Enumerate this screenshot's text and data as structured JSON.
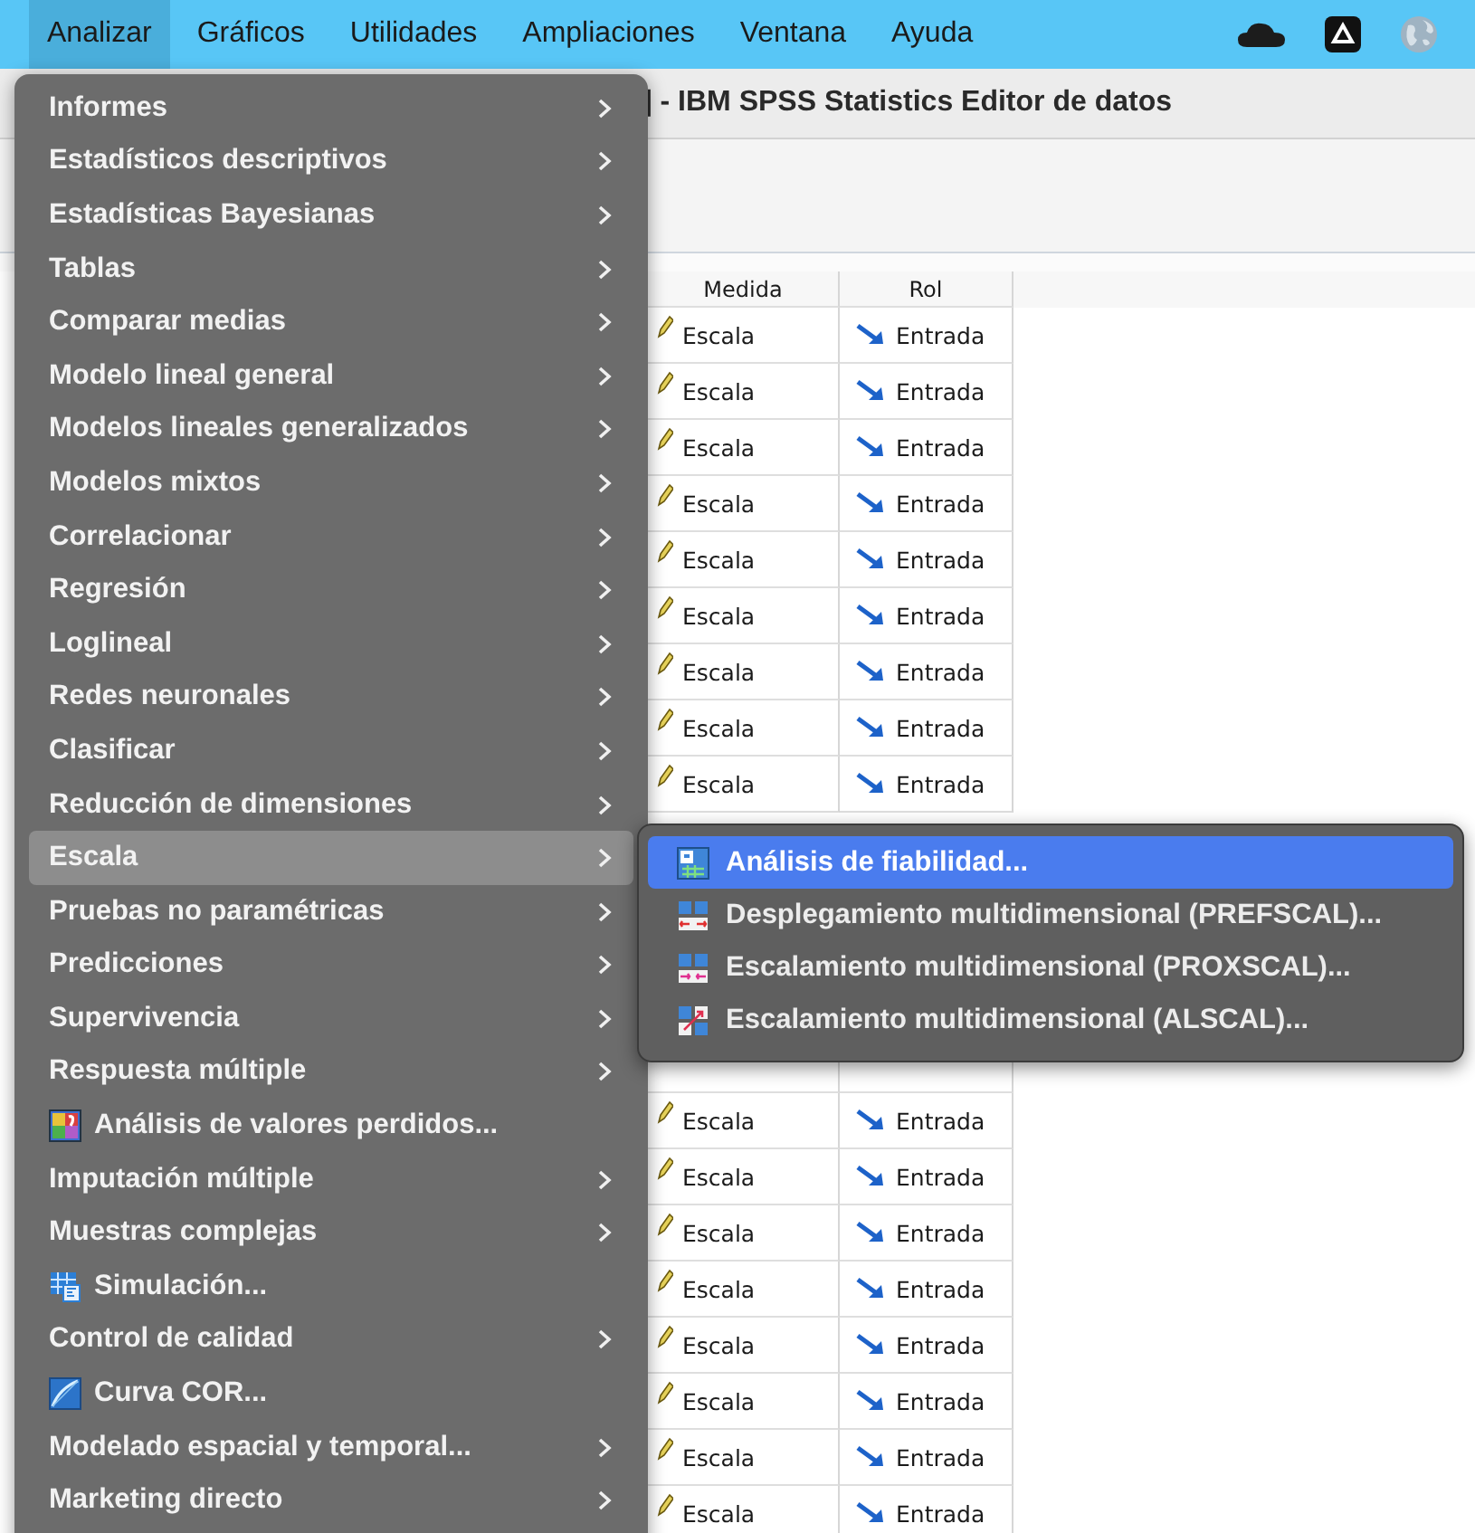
{
  "menubar": {
    "items": [
      {
        "label": "Analizar",
        "selected": true
      },
      {
        "label": "Gráficos",
        "selected": false
      },
      {
        "label": "Utilidades",
        "selected": false
      },
      {
        "label": "Ampliaciones",
        "selected": false
      },
      {
        "label": "Ventana",
        "selected": false
      },
      {
        "label": "Ayuda",
        "selected": false
      }
    ]
  },
  "window": {
    "title": "] - IBM SPSS Statistics Editor de datos"
  },
  "grid": {
    "columns": [
      "Medida",
      "Rol"
    ],
    "rows_above_menu": [
      {
        "measure": "Escala",
        "role": "Entrada"
      },
      {
        "measure": "Escala",
        "role": "Entrada"
      },
      {
        "measure": "Escala",
        "role": "Entrada"
      },
      {
        "measure": "Escala",
        "role": "Entrada"
      },
      {
        "measure": "Escala",
        "role": "Entrada"
      },
      {
        "measure": "Escala",
        "role": "Entrada"
      },
      {
        "measure": "Escala",
        "role": "Entrada"
      },
      {
        "measure": "Escala",
        "role": "Entrada"
      },
      {
        "measure": "Escala",
        "role": "Entrada"
      }
    ],
    "rows_below_menu": [
      {
        "measure": "Escala",
        "role": "Entrada"
      },
      {
        "measure": "Escala",
        "role": "Entrada"
      },
      {
        "measure": "Escala",
        "role": "Entrada"
      },
      {
        "measure": "Escala",
        "role": "Entrada"
      },
      {
        "measure": "Escala",
        "role": "Entrada"
      },
      {
        "measure": "Escala",
        "role": "Entrada"
      },
      {
        "measure": "Escala",
        "role": "Entrada"
      },
      {
        "measure": "Escala",
        "role": "Entrada"
      }
    ]
  },
  "menu": {
    "items": [
      {
        "label": "Informes",
        "kind": "submenu",
        "selected": false
      },
      {
        "label": "Estadísticos descriptivos",
        "kind": "submenu",
        "selected": false
      },
      {
        "label": "Estadísticas Bayesianas",
        "kind": "submenu",
        "selected": false
      },
      {
        "label": "Tablas",
        "kind": "submenu",
        "selected": false
      },
      {
        "label": "Comparar medias",
        "kind": "submenu",
        "selected": false
      },
      {
        "label": "Modelo lineal general",
        "kind": "submenu",
        "selected": false
      },
      {
        "label": "Modelos lineales generalizados",
        "kind": "submenu",
        "selected": false
      },
      {
        "label": "Modelos mixtos",
        "kind": "submenu",
        "selected": false
      },
      {
        "label": "Correlacionar",
        "kind": "submenu",
        "selected": false
      },
      {
        "label": "Regresión",
        "kind": "submenu",
        "selected": false
      },
      {
        "label": "Loglineal",
        "kind": "submenu",
        "selected": false
      },
      {
        "label": "Redes neuronales",
        "kind": "submenu",
        "selected": false
      },
      {
        "label": "Clasificar",
        "kind": "submenu",
        "selected": false
      },
      {
        "label": "Reducción de dimensiones",
        "kind": "submenu",
        "selected": false
      },
      {
        "label": "Escala",
        "kind": "submenu",
        "selected": true
      },
      {
        "label": "Pruebas no paramétricas",
        "kind": "submenu",
        "selected": false
      },
      {
        "label": "Predicciones",
        "kind": "submenu",
        "selected": false
      },
      {
        "label": "Supervivencia",
        "kind": "submenu",
        "selected": false
      },
      {
        "label": "Respuesta múltiple",
        "kind": "submenu",
        "selected": false
      },
      {
        "label": "Análisis de valores perdidos...",
        "kind": "action",
        "selected": false
      },
      {
        "label": "Imputación múltiple",
        "kind": "submenu",
        "selected": false
      },
      {
        "label": "Muestras complejas",
        "kind": "submenu",
        "selected": false
      },
      {
        "label": "Simulación...",
        "kind": "action",
        "selected": false
      },
      {
        "label": "Control de calidad",
        "kind": "submenu",
        "selected": false
      },
      {
        "label": "Curva COR...",
        "kind": "action",
        "selected": false
      },
      {
        "label": "Modelado espacial y temporal...",
        "kind": "submenu",
        "selected": false
      },
      {
        "label": "Marketing directo",
        "kind": "submenu",
        "selected": false
      }
    ]
  },
  "submenu": {
    "items": [
      {
        "label": "Análisis de fiabilidad...",
        "selected": true
      },
      {
        "label": "Desplegamiento multidimensional (PREFSCAL)...",
        "selected": false
      },
      {
        "label": "Escalamiento multidimensional (PROXSCAL)...",
        "selected": false
      },
      {
        "label": "Escalamiento multidimensional (ALSCAL)...",
        "selected": false
      }
    ]
  }
}
